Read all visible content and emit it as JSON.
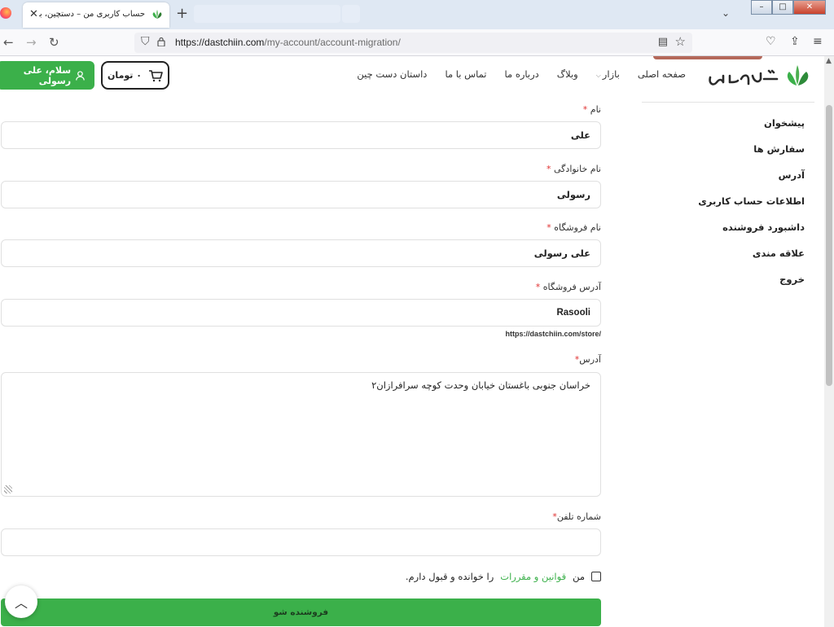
{
  "browser": {
    "tab_title": "حساب کاربری من – دستچین، بازار",
    "url_host": "https://dastchiin.com",
    "url_path": "/my-account/account-migration/",
    "new_tab": "+",
    "close_tab": "✕"
  },
  "header": {
    "login_label": "سلام، علی رسولی",
    "cart_label": "۰ تومان",
    "menu": [
      {
        "label": "صفحه اصلی"
      },
      {
        "label": "بازار"
      },
      {
        "label": "وبلاگ"
      },
      {
        "label": "درباره ما"
      },
      {
        "label": "تماس با ما"
      },
      {
        "label": "داستان دست چین"
      }
    ]
  },
  "sidebar": {
    "items": [
      {
        "label": "پیشخوان"
      },
      {
        "label": "سفارش ها"
      },
      {
        "label": "آدرس"
      },
      {
        "label": "اطلاعات حساب کاربری"
      },
      {
        "label": "داشبورد فروشنده"
      },
      {
        "label": "علاقه مندی"
      },
      {
        "label": "خروج"
      }
    ]
  },
  "form": {
    "first_name": {
      "label": "نام",
      "required": "*",
      "value": "علی"
    },
    "last_name": {
      "label": "نام خانوادگی",
      "required": "*",
      "value": "رسولی"
    },
    "shop_name": {
      "label": "نام فروشگاه",
      "required": "*",
      "value": "علی رسولی"
    },
    "shop_url": {
      "label": "آدرس فروشگاه",
      "required": "*",
      "value": "Rasooli",
      "hint": "https://dastchiin.com/store/"
    },
    "address": {
      "label": "آدرس",
      "required": "*",
      "value": "خراسان جنوبی باغستان خیابان وحدت کوچه سرافرازان۲"
    },
    "phone": {
      "label": "شماره تلفن",
      "required": "*",
      "value": ""
    },
    "terms": {
      "prefix": "من",
      "link": "قوانین و مقررات",
      "suffix": "را خوانده و قبول دارم."
    },
    "submit_label": "فروشنده شو"
  },
  "colors": {
    "brand_green": "#3bb04a",
    "required_red": "#e03131"
  }
}
